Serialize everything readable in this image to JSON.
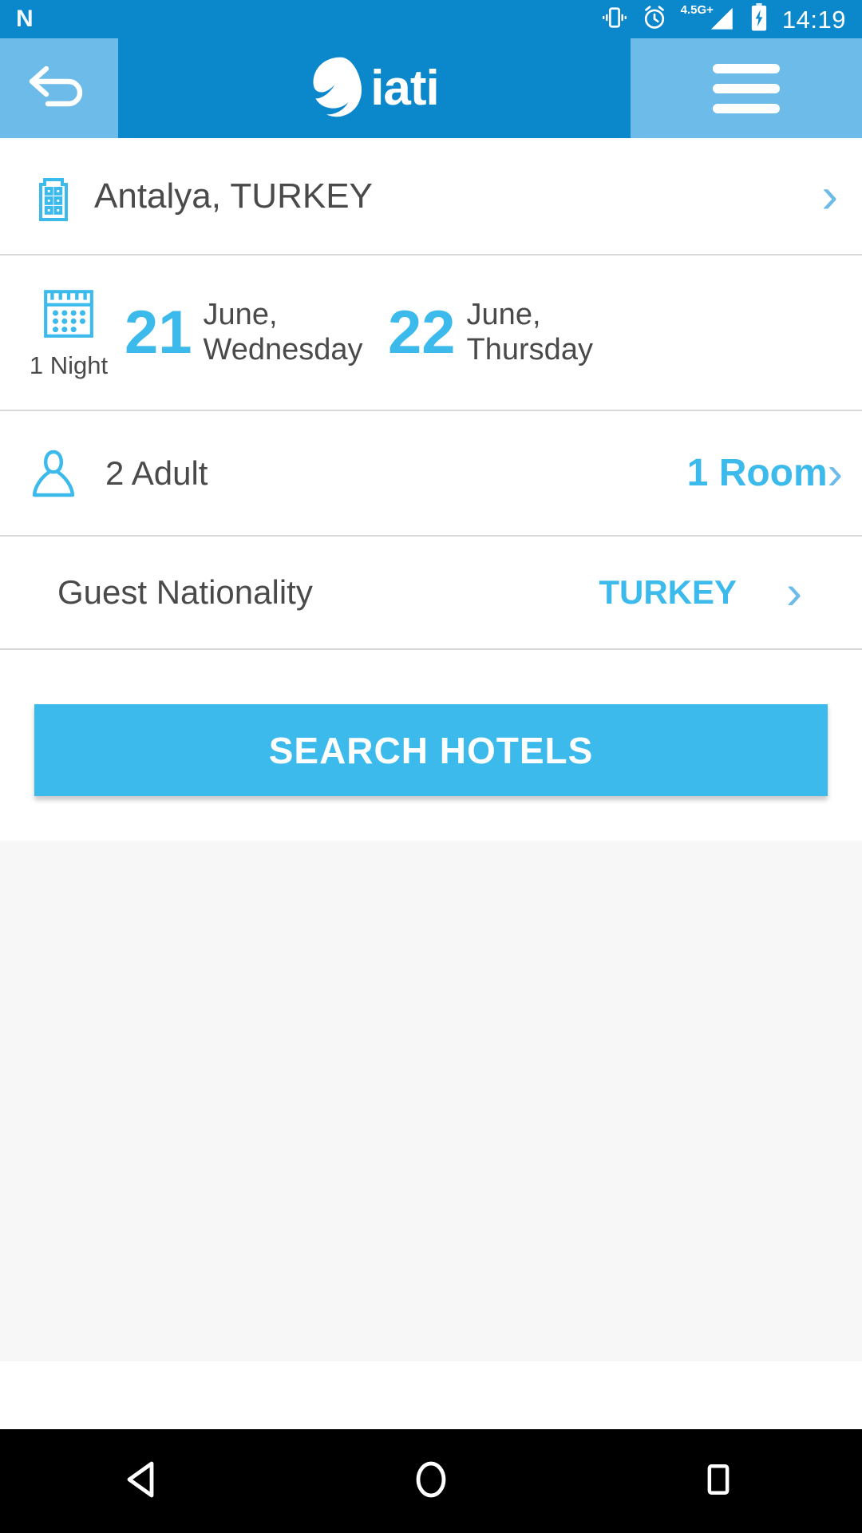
{
  "statusbar": {
    "app_badge": "N",
    "network_label": "4.5G+",
    "time": "14:19",
    "icons": [
      "vibrate-icon",
      "alarm-icon",
      "signal-icon",
      "battery-charging-icon"
    ]
  },
  "appbar": {
    "back_label": "back-arrow",
    "brand": "iati",
    "menu_label": "menu"
  },
  "search_form": {
    "destination": {
      "icon": "hotel-building-icon",
      "value": "Antalya, TURKEY"
    },
    "dates": {
      "icon": "calendar-icon",
      "nights": "1 Night",
      "checkin": {
        "day": "21",
        "month": "June,",
        "weekday": "Wednesday"
      },
      "checkout": {
        "day": "22",
        "month": "June,",
        "weekday": "Thursday"
      }
    },
    "guests": {
      "icon": "person-icon",
      "adults": "2 Adult",
      "rooms": "1 Room"
    },
    "nationality": {
      "label": "Guest Nationality",
      "value": "TURKEY"
    },
    "submit_label": "SEARCH HOTELS"
  },
  "navbar": {
    "back": "back-triangle",
    "home": "home-circle",
    "recents": "recents-square"
  },
  "colors": {
    "status_bar": "#0b87cc",
    "app_bar": "#0b87cc",
    "app_bar_side": "#6cbbe8",
    "accent": "#3cbaec",
    "text": "#4a4a4a",
    "divider": "#d8d8d8",
    "page_bg": "#f7f7f7"
  }
}
